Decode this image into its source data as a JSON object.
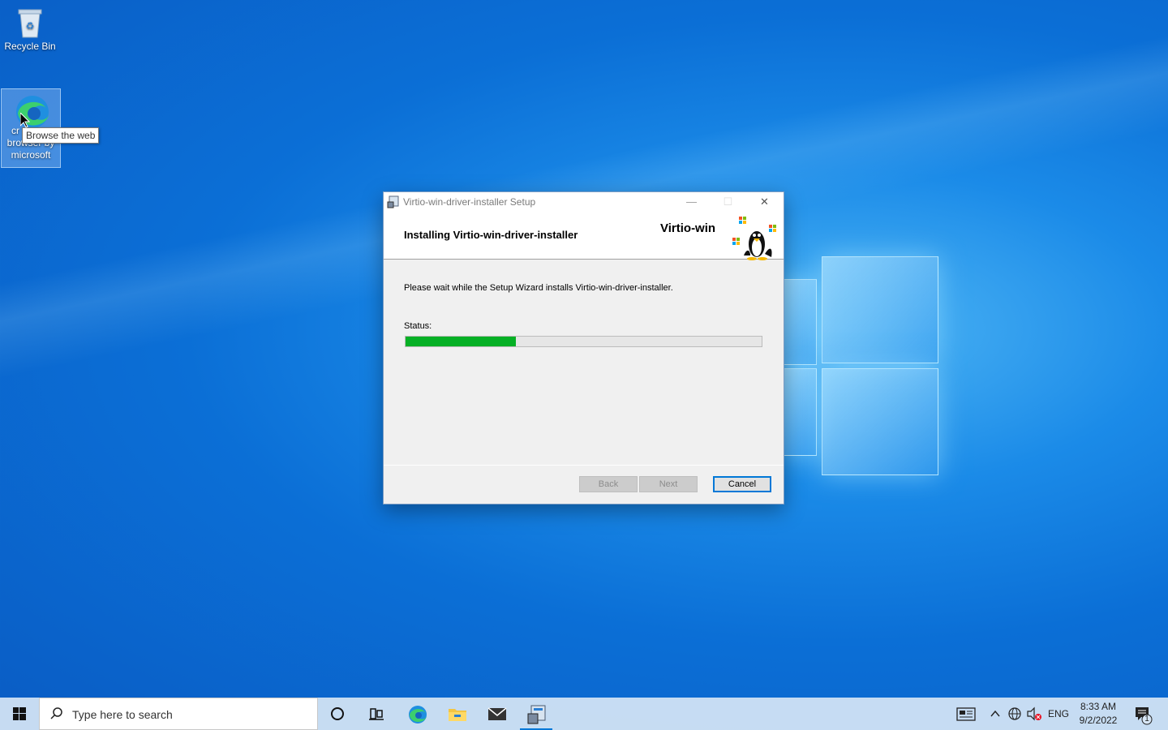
{
  "desktop": {
    "icons": [
      {
        "label": "Recycle Bin",
        "icon": "recycle-bin-icon"
      },
      {
        "label_lines": [
          "cr",
          "browser by",
          "microsoft"
        ],
        "icon": "edge-icon"
      }
    ],
    "tooltip": "Browse the web"
  },
  "dialog": {
    "title": "Virtio-win-driver-installer Setup",
    "heading": "Installing Virtio-win-driver-installer",
    "brand": "Virtio-win",
    "description": "Please wait while the Setup Wizard installs Virtio-win-driver-installer.",
    "status_label": "Status:",
    "progress_percent": 31,
    "progress_color": "#06b025",
    "buttons": {
      "back": "Back",
      "next": "Next",
      "cancel": "Cancel"
    },
    "title_controls": {
      "minimize": "—",
      "maximize": "☐",
      "close": "✕"
    }
  },
  "taskbar": {
    "search_placeholder": "Type here to search",
    "apps": [
      "cortana-icon",
      "task-view-icon",
      "edge-icon",
      "file-explorer-icon",
      "mail-icon",
      "setup-installer-icon"
    ],
    "tray": {
      "language": "ENG",
      "time": "8:33 AM",
      "date": "9/2/2022",
      "notification_count": "1"
    },
    "accent": "#0078d7"
  }
}
